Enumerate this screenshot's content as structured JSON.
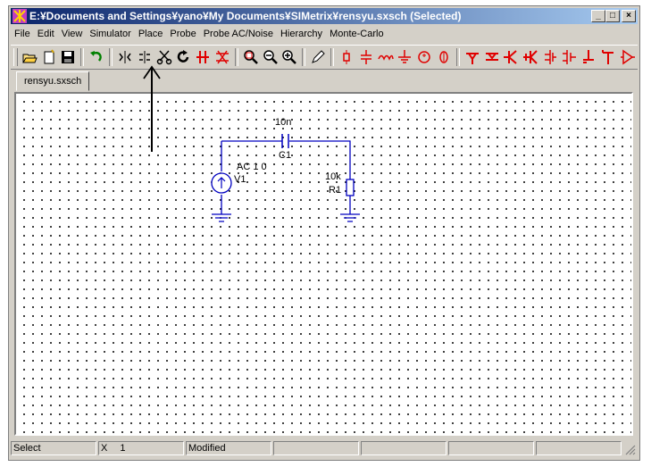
{
  "window": {
    "title": "E:¥Documents and Settings¥yano¥My Documents¥SIMetrix¥rensyu.sxsch (Selected)",
    "buttons": {
      "minimize": "_",
      "maximize": "□",
      "close": "×"
    }
  },
  "menu": {
    "items": [
      "File",
      "Edit",
      "View",
      "Simulator",
      "Place",
      "Probe",
      "Probe AC/Noise",
      "Hierarchy",
      "Monte-Carlo"
    ]
  },
  "toolbar": {
    "icons": [
      "open-folder",
      "new-file",
      "save",
      "undo",
      "rotate",
      "flip",
      "cut",
      "redo",
      "bus",
      "wire-delete",
      "zoom-fit",
      "zoom-out",
      "zoom-in",
      "pencil",
      "probe-voltage",
      "capacitor",
      "inductor",
      "ground",
      "voltage-source",
      "current-source",
      "npn",
      "pnp",
      "nmos",
      "pmos",
      "opamp",
      "diode",
      "resistor",
      "junction",
      "amplifier"
    ]
  },
  "tab": {
    "label": "rensyu.sxsch"
  },
  "schematic": {
    "capacitor": {
      "ref": "C1",
      "value": "10n"
    },
    "resistor": {
      "ref": "R1",
      "value": "10k"
    },
    "source": {
      "ref": "V1",
      "value": "AC 1 0"
    }
  },
  "status": {
    "mode": "Select",
    "coord_label": "X",
    "coord_value": "1",
    "modified": "Modified"
  },
  "colors": {
    "titlebar_start": "#0a246a",
    "titlebar_end": "#a6caf0",
    "schematic": "#0000c0",
    "toolbar_red": "#e00000"
  }
}
